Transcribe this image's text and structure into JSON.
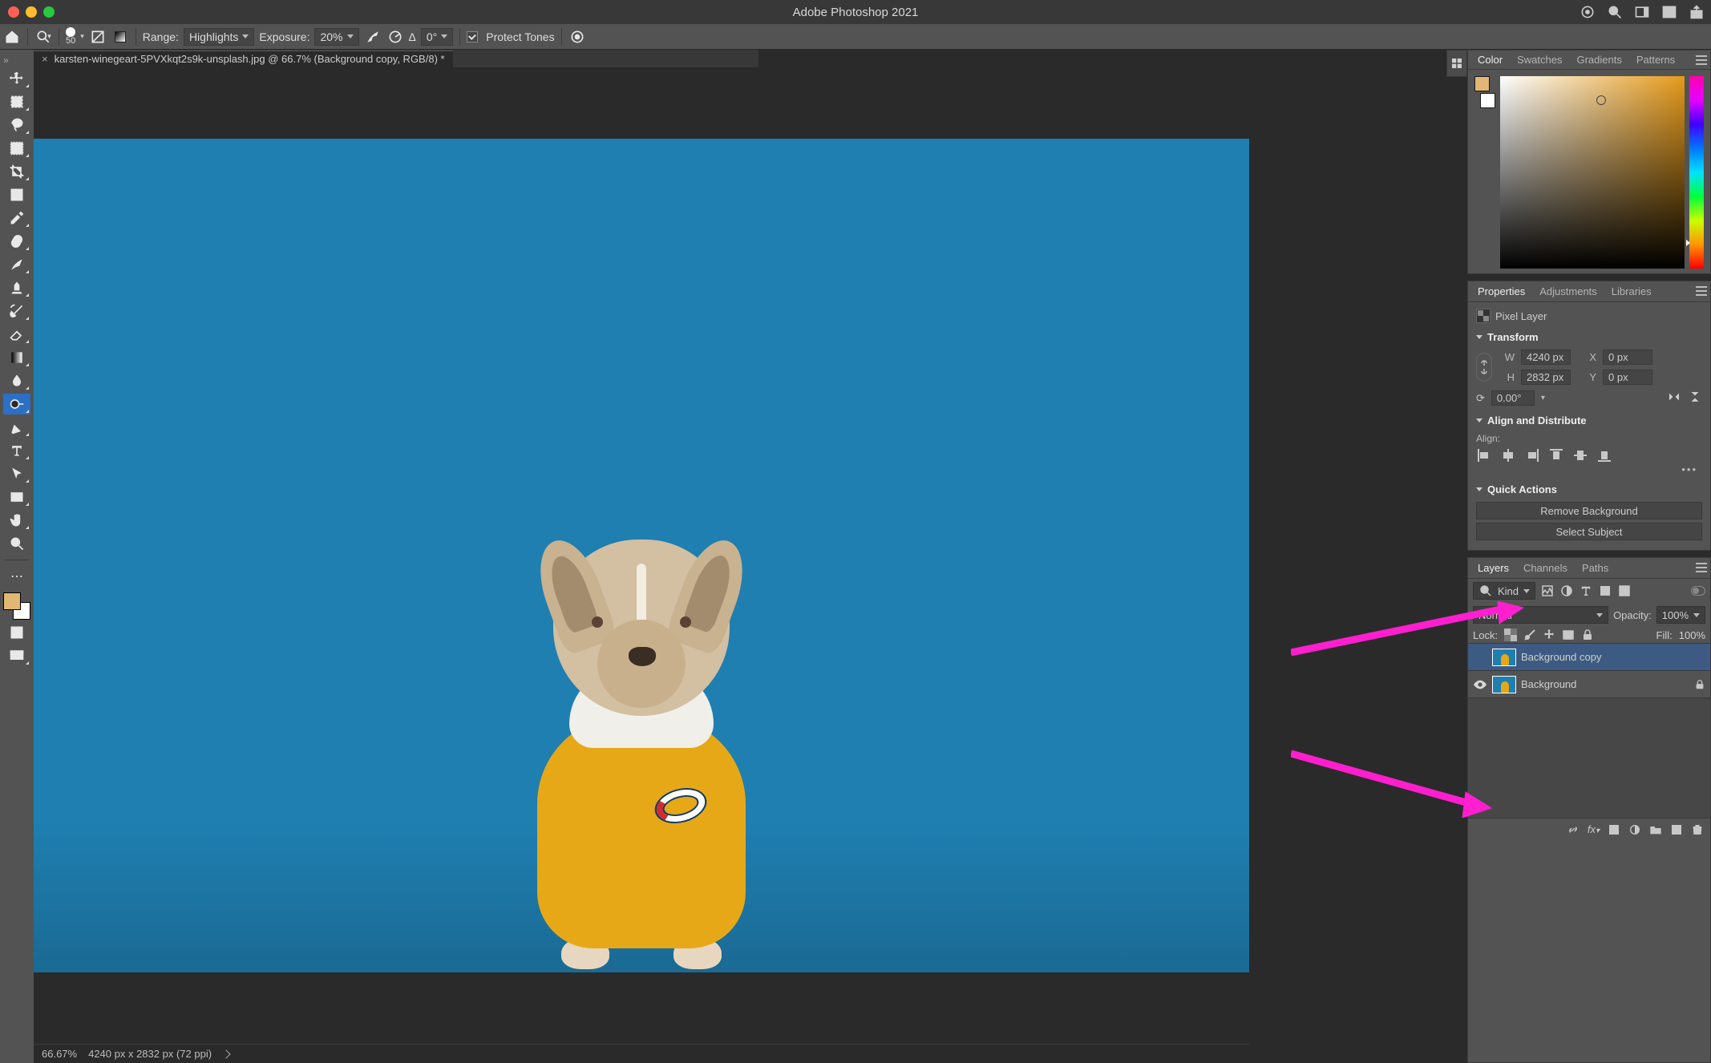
{
  "app_title": "Adobe Photoshop 2021",
  "traffic": [
    "close",
    "minimize",
    "zoom"
  ],
  "chrome_right_icons": [
    "cloud-sync-icon",
    "search-icon",
    "workspace-icon",
    "arrange-icon",
    "share-icon"
  ],
  "optionbar": {
    "home_icon": "home-icon",
    "brush": {
      "label": "50",
      "icon": "brush-preset-icon"
    },
    "gradient_preview": "gradient-icon",
    "range_label": "Range:",
    "range_value": "Highlights",
    "exposure_label": "Exposure:",
    "exposure_value": "20%",
    "airbrush_icon": "airbrush-icon",
    "angle_icon": "angle-icon",
    "angle_label": "Δ",
    "angle_value": "0°",
    "protect_checked": true,
    "protect_label": "Protect Tones",
    "pressure_icon": "tablet-pressure-icon"
  },
  "tab": {
    "title": "karsten-winegeart-5PVXkqt2s9k-unsplash.jpg @ 66.7% (Background copy, RGB/8) *",
    "close": "×"
  },
  "tools": [
    "move-tool",
    "rect-marquee-tool",
    "lasso-tool",
    "object-select-tool",
    "crop-tool",
    "frame-tool",
    "eyedropper-tool",
    "healing-brush-tool",
    "brush-tool",
    "clone-stamp-tool",
    "history-brush-tool",
    "eraser-tool",
    "gradient-tool",
    "blur-tool",
    "dodge-tool",
    "pen-tool",
    "type-tool",
    "path-select-tool",
    "rectangle-tool",
    "hand-tool",
    "zoom-tool"
  ],
  "tools_selected_index": 14,
  "tool_extras": [
    "edit-toolbar-icon",
    "foreground-background-swatch",
    "quickmask-icon",
    "screenmode-icon"
  ],
  "colors": {
    "foreground": "#e2b773",
    "background": "#ffffff"
  },
  "color_panel": {
    "tabs": [
      "Color",
      "Swatches",
      "Gradients",
      "Patterns"
    ],
    "active": 0
  },
  "properties_panel": {
    "tabs": [
      "Properties",
      "Adjustments",
      "Libraries"
    ],
    "active": 0,
    "kind_icon": "pixel-layer-icon",
    "kind_label": "Pixel Layer",
    "transform_label": "Transform",
    "W": "4240 px",
    "H": "2832 px",
    "X": "0 px",
    "Y": "0 px",
    "angle": "0.00°",
    "flip_h": "flip-horizontal-icon",
    "flip_v": "flip-vertical-icon",
    "align_label": "Align and Distribute",
    "align_caption": "Align:",
    "align_icons": [
      "align-left",
      "align-hcenter",
      "align-right",
      "align-top",
      "align-vcenter",
      "align-bottom"
    ],
    "quick_label": "Quick Actions",
    "btn_remove": "Remove Background",
    "btn_select": "Select Subject"
  },
  "layers_panel": {
    "tabs": [
      "Layers",
      "Channels",
      "Paths"
    ],
    "active": 0,
    "filter_kind_label": "Kind",
    "filter_icons": [
      "image-filter-icon",
      "adjustment-filter-icon",
      "type-filter-icon",
      "shape-filter-icon",
      "smartobj-filter-icon",
      "more-filter-icon"
    ],
    "blend_mode": "Normal",
    "opacity_label": "Opacity:",
    "opacity_value": "100%",
    "lock_label": "Lock:",
    "lock_icons": [
      "lock-transparent-icon",
      "lock-image-icon",
      "lock-position-icon",
      "lock-artboard-icon",
      "lock-all-icon"
    ],
    "fill_label": "Fill:",
    "fill_value": "100%",
    "layers": [
      {
        "name": "Background copy",
        "visible": false,
        "selected": true,
        "locked": false
      },
      {
        "name": "Background",
        "visible": true,
        "selected": false,
        "locked": true
      }
    ],
    "footer_icons": [
      "link-layers-icon",
      "fx-icon",
      "mask-icon",
      "adjustment-layer-icon",
      "group-icon",
      "new-layer-icon",
      "trash-icon"
    ]
  },
  "status": {
    "zoom": "66.67%",
    "dims": "4240 px x 2832 px (72 ppi)"
  },
  "annotations": [
    "arrow-to-remove-background",
    "arrow-to-layer"
  ]
}
